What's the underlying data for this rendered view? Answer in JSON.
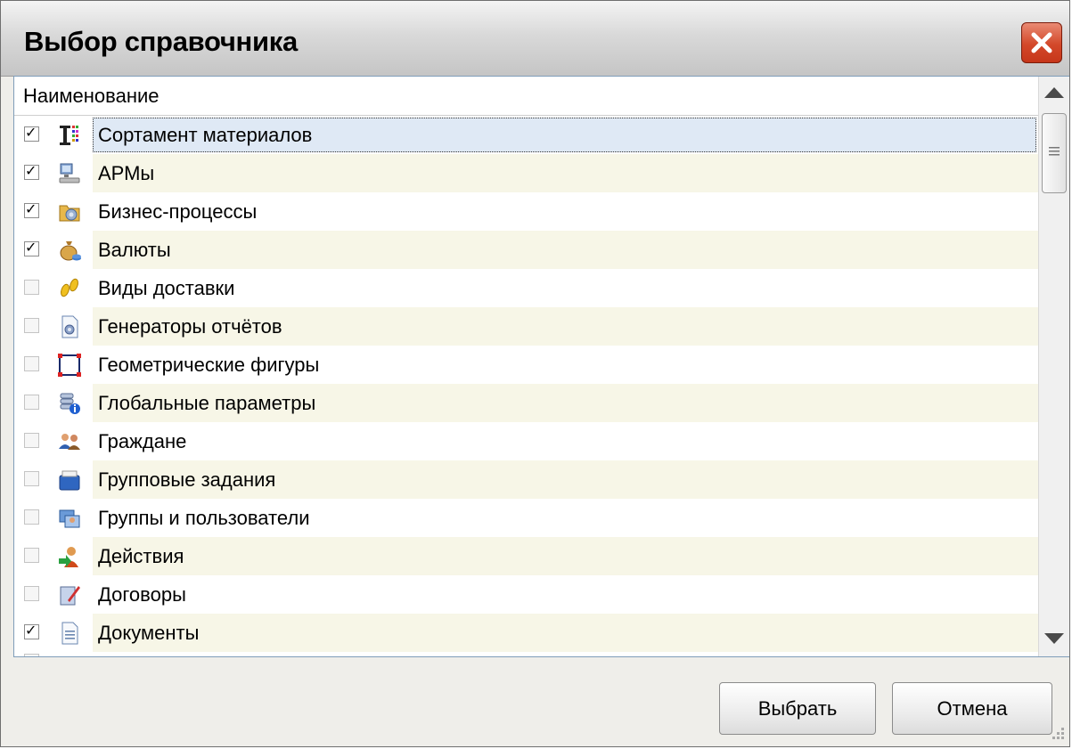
{
  "window": {
    "title": "Выбор справочника",
    "close_label": "✕"
  },
  "list": {
    "column_header": "Наименование",
    "items": [
      {
        "label": "Сортамент материалов",
        "checked": true,
        "icon": "sortament-icon",
        "selected": true
      },
      {
        "label": "АРМы",
        "checked": true,
        "icon": "workstation-icon"
      },
      {
        "label": "Бизнес-процессы",
        "checked": true,
        "icon": "business-process-icon"
      },
      {
        "label": "Валюты",
        "checked": true,
        "icon": "money-bag-icon"
      },
      {
        "label": "Виды доставки",
        "checked": false,
        "icon": "footprints-icon"
      },
      {
        "label": "Генераторы отчётов",
        "checked": false,
        "icon": "report-generator-icon"
      },
      {
        "label": "Геометрические фигуры",
        "checked": false,
        "icon": "shape-icon"
      },
      {
        "label": "Глобальные параметры",
        "checked": false,
        "icon": "global-params-icon"
      },
      {
        "label": "Граждане",
        "checked": false,
        "icon": "citizens-icon"
      },
      {
        "label": "Групповые задания",
        "checked": false,
        "icon": "group-tasks-icon"
      },
      {
        "label": "Группы и пользователи",
        "checked": false,
        "icon": "groups-users-icon"
      },
      {
        "label": "Действия",
        "checked": false,
        "icon": "actions-icon"
      },
      {
        "label": "Договоры",
        "checked": false,
        "icon": "contract-icon"
      },
      {
        "label": "Документы",
        "checked": true,
        "icon": "document-icon"
      }
    ]
  },
  "buttons": {
    "select": "Выбрать",
    "cancel": "Отмена"
  },
  "colors": {
    "alt_row": "#f7f6e7",
    "selected_row": "#dfe9f5",
    "close_button": "#d3482a"
  }
}
